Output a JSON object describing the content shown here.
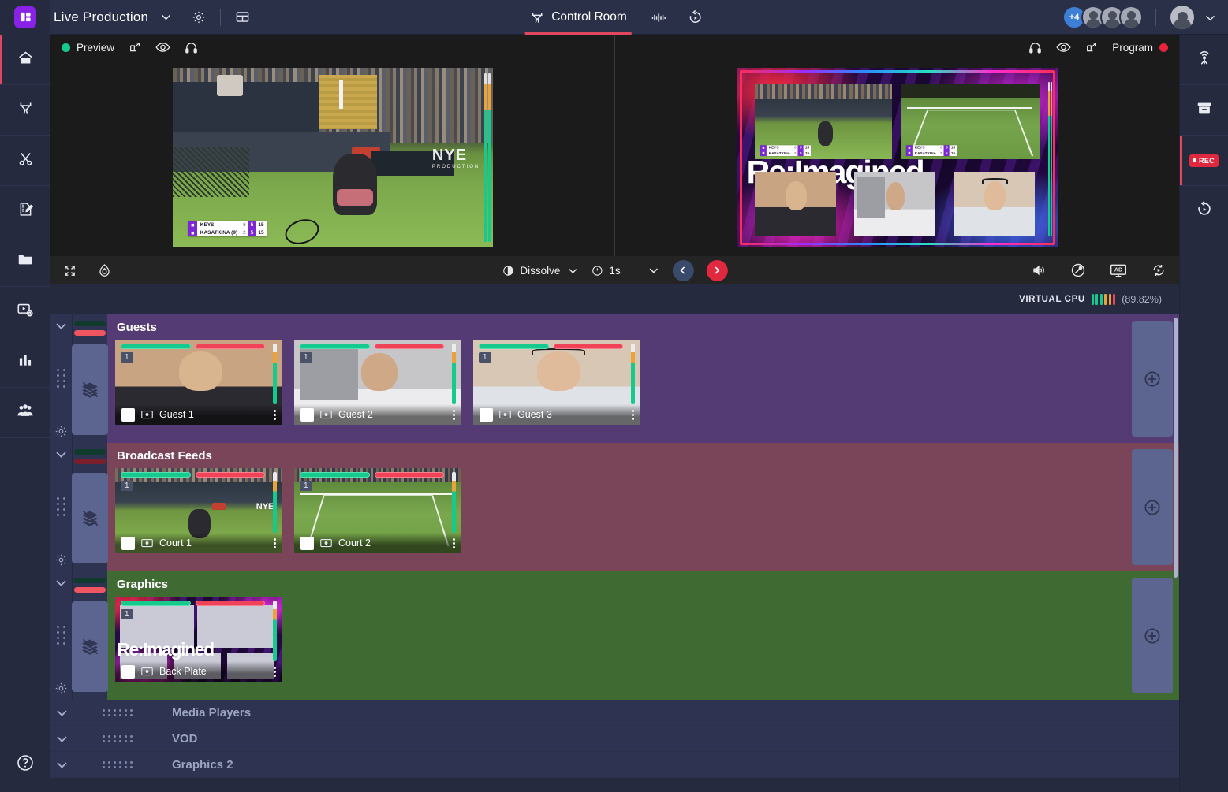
{
  "header": {
    "app_title": "Live Production",
    "logo_icon": "app-logo-icon",
    "chevron_icon": "chevron-down-icon",
    "settings_icon": "gear-icon",
    "layout_icon": "layout-icon",
    "nav": {
      "active_tab": "Control Room",
      "tab_icon": "director-chair-icon",
      "audio_icon": "audio-mixer-icon",
      "replay_icon": "replay-icon"
    },
    "avatars": {
      "overflow_label": "+4",
      "count": 3
    },
    "account_chevron": "chevron-down-icon"
  },
  "left_rail": [
    {
      "name": "home",
      "icon": "home-icon",
      "active": true
    },
    {
      "name": "production",
      "icon": "director-chair-icon",
      "active": false
    },
    {
      "name": "edit",
      "icon": "scissors-icon",
      "active": false
    },
    {
      "name": "notes",
      "icon": "ruler-pencil-icon",
      "active": false
    },
    {
      "name": "media",
      "icon": "folder-icon",
      "active": false
    },
    {
      "name": "player-settings",
      "icon": "media-settings-icon",
      "active": false
    },
    {
      "name": "analytics",
      "icon": "bar-chart-icon",
      "active": false
    },
    {
      "name": "people",
      "icon": "people-icon",
      "active": false
    }
  ],
  "left_rail_help_icon": "help-circle-icon",
  "right_rail": [
    {
      "name": "broadcast",
      "icon": "antenna-icon",
      "active": false
    },
    {
      "name": "archive",
      "icon": "archive-box-icon",
      "active": false
    },
    {
      "name": "record",
      "icon": "rec-badge-icon",
      "label": "REC",
      "active": true
    },
    {
      "name": "replay",
      "icon": "replay-icon",
      "active": false
    }
  ],
  "preview": {
    "label": "Preview",
    "status_dot_color": "#16c98d",
    "popout_icon": "popout-icon",
    "eye_icon": "eye-icon",
    "headphones_icon": "headphones-icon",
    "scorebug": {
      "player1": "KEYS",
      "player2": "KASATKINA",
      "player2_seed": "(9)",
      "p1_scores": [
        "6",
        "5",
        "15"
      ],
      "p2_scores": [
        "2",
        "5",
        "15"
      ]
    }
  },
  "program": {
    "label": "Program",
    "status_dot_color": "#e8243c",
    "popout_icon": "popout-icon",
    "eye_icon": "eye-icon",
    "headphones_icon": "headphones-icon",
    "overlay_text": "Re:Imagined"
  },
  "transition_bar": {
    "fullscreen_icon": "fullscreen-icon",
    "flame_icon": "flame-icon",
    "transition_icon": "transition-contrast-icon",
    "transition_name": "Dissolve",
    "transition_chevron": "chevron-down-icon",
    "duration_icon": "timer-icon",
    "duration": "1s",
    "duration_chevron": "chevron-down-icon",
    "prev_icon": "chevron-left-icon",
    "take_icon": "chevron-right-icon",
    "volume_icon": "speaker-icon",
    "fx_icon": "comet-icon",
    "ad_icon": "ad-screen-icon",
    "ad_label": "AD",
    "transition_loop_icon": "loop-play-icon"
  },
  "cpu": {
    "label": "VIRTUAL CPU",
    "percent": "(89.82%)",
    "value": 89.82,
    "bar_colors": [
      "#16c98d",
      "#16c98d",
      "#16c98d",
      "#e8a33a",
      "#e8a33a",
      "#f04358"
    ]
  },
  "rows": [
    {
      "title": "Guests",
      "accent": "#553b73",
      "tally_top": "#0f3a2c",
      "tally_bottom": "#f0565f",
      "chevron_icon": "chevron-down-icon",
      "grip_icon": "drag-handle-icon",
      "gear_icon": "gear-icon",
      "layers_icon": "layers-off-icon",
      "add_icon": "plus-circle-icon",
      "items": [
        {
          "number": "1",
          "name": "Guest 1",
          "source_icon": "camera-source-icon",
          "kebab_icon": "kebab-menu-icon",
          "checkbox": "checkbox"
        },
        {
          "number": "1",
          "name": "Guest 2",
          "source_icon": "camera-source-icon",
          "kebab_icon": "kebab-menu-icon",
          "checkbox": "checkbox"
        },
        {
          "number": "1",
          "name": "Guest 3",
          "source_icon": "camera-source-icon",
          "kebab_icon": "kebab-menu-icon",
          "checkbox": "checkbox"
        }
      ]
    },
    {
      "title": "Broadcast Feeds",
      "accent": "#7a4459",
      "tally_top": "#0f3a2c",
      "tally_bottom": "#7a1f2c",
      "chevron_icon": "chevron-down-icon",
      "grip_icon": "drag-handle-icon",
      "gear_icon": "gear-icon",
      "layers_icon": "layers-off-icon",
      "add_icon": "plus-circle-icon",
      "items": [
        {
          "number": "1",
          "name": "Court 1",
          "source_icon": "camera-source-icon",
          "kebab_icon": "kebab-menu-icon",
          "checkbox": "checkbox"
        },
        {
          "number": "1",
          "name": "Court 2",
          "source_icon": "camera-source-icon",
          "kebab_icon": "kebab-menu-icon",
          "checkbox": "checkbox"
        }
      ]
    },
    {
      "title": "Graphics",
      "accent": "#3f6b33",
      "tally_top": "#0f3a2c",
      "tally_bottom": "#f0565f",
      "chevron_icon": "chevron-down-icon",
      "grip_icon": "drag-handle-icon",
      "gear_icon": "gear-icon",
      "layers_icon": "layers-off-icon",
      "add_icon": "plus-circle-icon",
      "items": [
        {
          "number": "1",
          "name": "Back Plate",
          "source_icon": "camera-source-icon",
          "kebab_icon": "kebab-menu-icon",
          "checkbox": "checkbox"
        }
      ]
    }
  ],
  "collapsed_rows": [
    {
      "title": "Media Players",
      "chevron_icon": "chevron-down-icon",
      "grip_icon": "drag-handle-icon"
    },
    {
      "title": "VOD",
      "chevron_icon": "chevron-down-icon",
      "grip_icon": "drag-handle-icon"
    },
    {
      "title": "Graphics 2",
      "chevron_icon": "chevron-down-icon",
      "grip_icon": "drag-handle-icon"
    }
  ]
}
